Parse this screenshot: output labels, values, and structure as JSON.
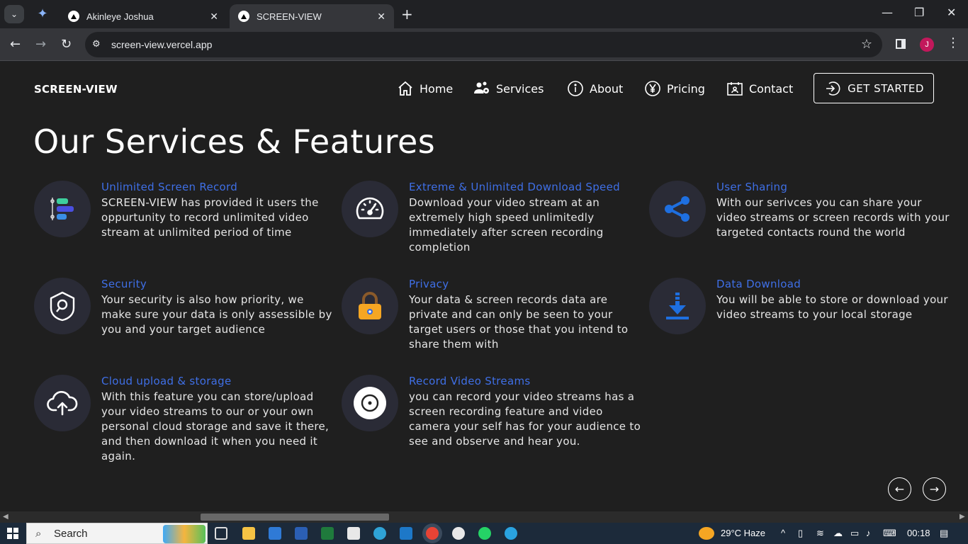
{
  "browser": {
    "tabs": [
      {
        "title": "Akinleye Joshua"
      },
      {
        "title": "SCREEN-VIEW"
      }
    ],
    "url": "screen-view.vercel.app",
    "profile_initial": "J"
  },
  "site": {
    "brand": "SCREEN-VIEW",
    "nav": [
      {
        "label": "Home",
        "icon": "home-icon"
      },
      {
        "label": "Services",
        "icon": "users-cog-icon"
      },
      {
        "label": "About",
        "icon": "info-icon"
      },
      {
        "label": "Pricing",
        "icon": "yen-icon"
      },
      {
        "label": "Contact",
        "icon": "contact-card-icon"
      }
    ],
    "cta": "GET STARTED",
    "heading": "Our Services & Features",
    "features": [
      {
        "title": "Unlimited Screen Record",
        "desc": "SCREEN-VIEW has provided it users the oppurtunity to record unlimited video stream at unlimited period of time",
        "icon": "timeline-icon"
      },
      {
        "title": "Extreme & Unlimited Download Speed",
        "desc": "Download your video stream at an extremely high speed unlimitedly immediately after screen recording completion",
        "icon": "speedometer-icon"
      },
      {
        "title": "User Sharing",
        "desc": "With our serivces you can share your video streams or screen records with your targeted contacts round the world",
        "icon": "share-icon"
      },
      {
        "title": "Security",
        "desc": "Your security is also how priority, we make sure your data is only assessible by you and your target audience",
        "icon": "shield-search-icon"
      },
      {
        "title": "Privacy",
        "desc": "Your data & screen records data are private and can only be seen to your target users or those that you intend to share them with",
        "icon": "lock-icon"
      },
      {
        "title": "Data Download",
        "desc": "You will be able to store or download your video streams to your local storage",
        "icon": "download-icon"
      },
      {
        "title": "Cloud upload & storage",
        "desc": "With this feature you can store/upload your video streams to our or your own personal cloud storage and save it there, and then download it when you need it again.",
        "icon": "cloud-upload-icon"
      },
      {
        "title": "Record Video Streams",
        "desc": "you can record your video streams has a screen recording feature and video camera your self has for your audience to see and observe and hear you.",
        "icon": "record-icon"
      }
    ]
  },
  "taskbar": {
    "search_placeholder": "Search",
    "weather": "29°C  Haze",
    "time": "00:18"
  },
  "colors": {
    "accent": "#3f6fe6",
    "page_bg": "#1f1f1f",
    "icon_circle": "#2a2b36"
  }
}
